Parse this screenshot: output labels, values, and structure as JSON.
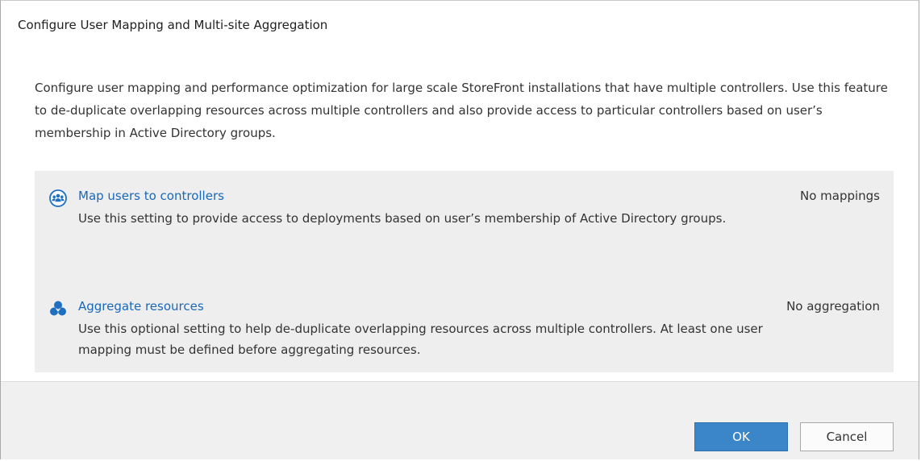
{
  "dialog": {
    "title": "Configure User Mapping and Multi-site Aggregation",
    "intro": "Configure user mapping and performance optimization for large scale StoreFront installations that have multiple controllers. Use this feature to de-duplicate overlapping resources across multiple controllers and also provide access to particular controllers based on user’s membership in Active Directory groups."
  },
  "settings": [
    {
      "icon": "users-group-icon",
      "label": "Map users to controllers",
      "status": "No mappings",
      "description": "Use this setting to provide access to deployments based on user’s membership of Active Directory groups."
    },
    {
      "icon": "aggregate-resources-icon",
      "label": "Aggregate resources",
      "status": "No aggregation",
      "description": "Use this optional setting to help de-duplicate overlapping resources across multiple controllers. At least one user mapping must be defined before aggregating resources."
    }
  ],
  "buttons": {
    "ok": "OK",
    "cancel": "Cancel"
  },
  "colors": {
    "link": "#1a68b8",
    "primary_button": "#3a86c8",
    "panel_background": "#eeeeee",
    "footer_background": "#f0f0f0"
  }
}
